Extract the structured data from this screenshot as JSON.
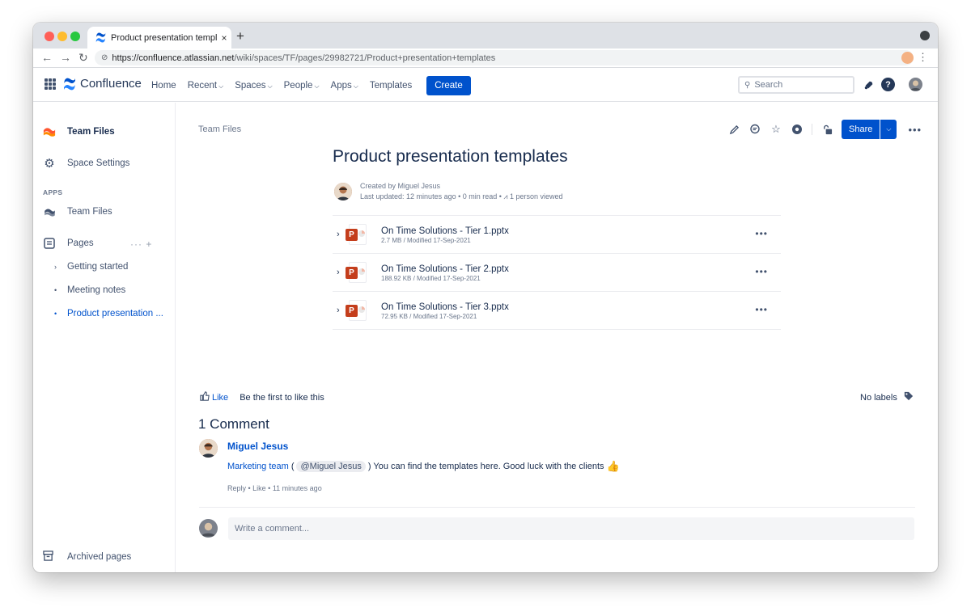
{
  "browser": {
    "tab_title": "Product presentation template",
    "tab_close": "×",
    "new_tab": "+",
    "url_host": "https://confluence.atlassian.net",
    "url_path": "/wiki/spaces/TF/pages/29982721/Product+presentation+templates"
  },
  "header": {
    "logo_text": "Confluence",
    "nav": [
      {
        "label": "Home",
        "dropdown": false
      },
      {
        "label": "Recent",
        "dropdown": true
      },
      {
        "label": "Spaces",
        "dropdown": true
      },
      {
        "label": "People",
        "dropdown": true
      },
      {
        "label": "Apps",
        "dropdown": true
      },
      {
        "label": "Templates",
        "dropdown": false
      }
    ],
    "create_label": "Create",
    "search_placeholder": "Search",
    "help_label": "?"
  },
  "sidebar": {
    "space_name": "Team Files",
    "space_settings": "Space Settings",
    "apps_heading": "APPS",
    "app_item": "Team Files",
    "pages_label": "Pages",
    "pages_actions": "··· +",
    "tree": [
      {
        "label": "Getting started",
        "bullet": "›",
        "active": false
      },
      {
        "label": "Meeting notes",
        "bullet": "•",
        "active": false
      },
      {
        "label": "Product presentation ...",
        "bullet": "•",
        "active": true
      }
    ],
    "archived": "Archived pages"
  },
  "page": {
    "breadcrumb": "Team Files",
    "share_label": "Share",
    "title": "Product presentation templates",
    "created_by": "Created by Miguel Jesus",
    "last_updated": "Last updated: 12 minutes ago • 0 min read • ",
    "viewed": "1 person viewed",
    "attachments": [
      {
        "name": "On Time Solutions - Tier 1.pptx",
        "meta": "2.7 MB / Modified 17-Sep-2021"
      },
      {
        "name": "On Time Solutions - Tier 2.pptx",
        "meta": "188.92 KB / Modified 17-Sep-2021"
      },
      {
        "name": "On Time Solutions - Tier 3.pptx",
        "meta": "72.95 KB / Modified 17-Sep-2021"
      }
    ],
    "like_label": "Like",
    "like_text": "Be the first to like this",
    "labels_text": "No labels"
  },
  "comments": {
    "title": "1 Comment",
    "items": [
      {
        "author": "Miguel Jesus",
        "link": "Marketing team",
        "open_paren": "(",
        "mention": "@Miguel Jesus",
        "text": ") You can find the templates here. Good luck with the clients",
        "meta": "Reply • Like • 11 minutes ago"
      }
    ],
    "write_placeholder": "Write a comment..."
  },
  "colors": {
    "brand": "#0052cc",
    "text": "#172b4d",
    "subtle": "#6b778c",
    "ppt": "#c43e1c"
  }
}
